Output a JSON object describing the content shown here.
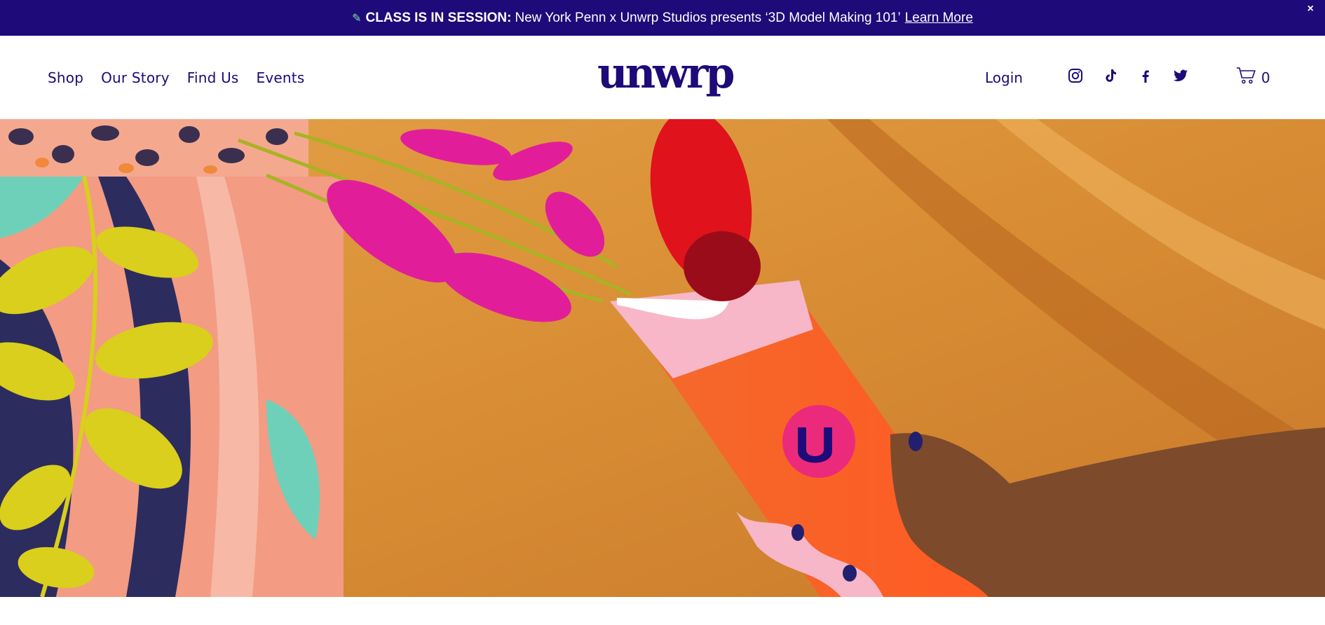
{
  "announcement": {
    "icon": "pencil-icon",
    "bold": "CLASS IS IN SESSION:",
    "text": "New York Penn x Unwrp Studios presents ‘3D Model Making 101’",
    "link": "Learn More",
    "close": "×"
  },
  "header": {
    "nav": [
      "Shop",
      "Our Story",
      "Find Us",
      "Events"
    ],
    "logo": "unwrp",
    "login": "Login",
    "social": [
      "instagram-icon",
      "tiktok-icon",
      "facebook-icon",
      "twitter-icon"
    ],
    "cart_count": "0"
  },
  "colors": {
    "brand": "#1e0a78",
    "announce_bg": "#1e0a78",
    "page_bg": "#ffffff"
  }
}
